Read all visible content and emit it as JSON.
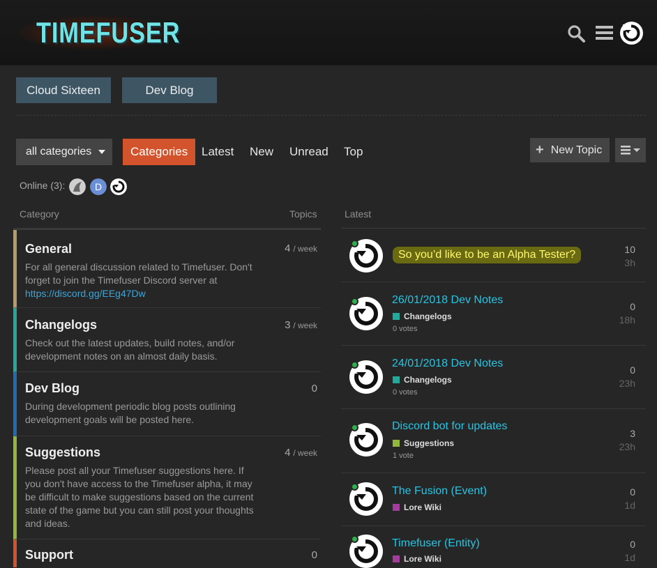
{
  "header": {
    "logo_text": "TIMEFUSER",
    "icons": [
      "search-icon",
      "hamburger-menu-icon",
      "user-avatar"
    ]
  },
  "nav_buttons": [
    {
      "label": "Cloud Sixteen"
    },
    {
      "label": "Dev Blog"
    }
  ],
  "toolbar": {
    "category_dropdown": "all categories",
    "tabs": [
      {
        "label": "Categories",
        "active": true
      },
      {
        "label": "Latest"
      },
      {
        "label": "New"
      },
      {
        "label": "Unread"
      },
      {
        "label": "Top"
      }
    ],
    "new_topic_label": "New Topic"
  },
  "online": {
    "label": "Online (3):",
    "users": [
      {
        "initial": "",
        "color": "#9a9a9a"
      },
      {
        "initial": "D",
        "color": "#6b8fd6"
      },
      {
        "initial": "",
        "color": "#ffffff"
      }
    ]
  },
  "categories_header": {
    "category": "Category",
    "topics": "Topics",
    "latest": "Latest"
  },
  "categories": [
    {
      "name": "General",
      "color": "#b69a6a",
      "count": "4",
      "period": "week",
      "description": "For all general discussion related to Timefuser. Don't forget to join the Timefuser Discord server at",
      "link": "https://discord.gg/EEg47Dw"
    },
    {
      "name": "Changelogs",
      "color": "#25a89c",
      "count": "3",
      "period": "week",
      "description": "Check out the latest updates, build notes, and/or development notes on an almost daily basis."
    },
    {
      "name": "Dev Blog",
      "color": "#1f6cb3",
      "count": "0",
      "period": "",
      "description": "During development periodic blog posts outlining development goals will be posted here."
    },
    {
      "name": "Suggestions",
      "color": "#93b63c",
      "count": "4",
      "period": "week",
      "description": "Please post all your Timefuser suggestions here. If you don't have access to the Timefuser alpha, it may be difficult to make suggestions based on the current state of the game but you can still post your thoughts and ideas."
    },
    {
      "name": "Support",
      "color": "#d3542c",
      "count": "0",
      "period": "",
      "description": ""
    }
  ],
  "latest_topics": [
    {
      "title": "So you’d like to be an Alpha Tester?",
      "highlight": true,
      "category": "",
      "cat_color": "",
      "votes": "",
      "replies": "10",
      "age": "3h"
    },
    {
      "title": "26/01/2018 Dev Notes",
      "category": "Changelogs",
      "cat_color": "#25a89c",
      "votes": "0 votes",
      "replies": "0",
      "age": "18h"
    },
    {
      "title": "24/01/2018 Dev Notes",
      "category": "Changelogs",
      "cat_color": "#25a89c",
      "votes": "0 votes",
      "replies": "0",
      "age": "23h"
    },
    {
      "title": "Discord bot for updates",
      "category": "Suggestions",
      "cat_color": "#93b63c",
      "votes": "1 vote",
      "replies": "3",
      "age": "23h"
    },
    {
      "title": "The Fusion (Event)",
      "category": "Lore Wiki",
      "cat_color": "#a33d9b",
      "votes": "",
      "replies": "0",
      "age": "1d"
    },
    {
      "title": "Timefuser (Entity)",
      "category": "Lore Wiki",
      "cat_color": "#a33d9b",
      "votes": "",
      "replies": "0",
      "age": "1d"
    }
  ]
}
